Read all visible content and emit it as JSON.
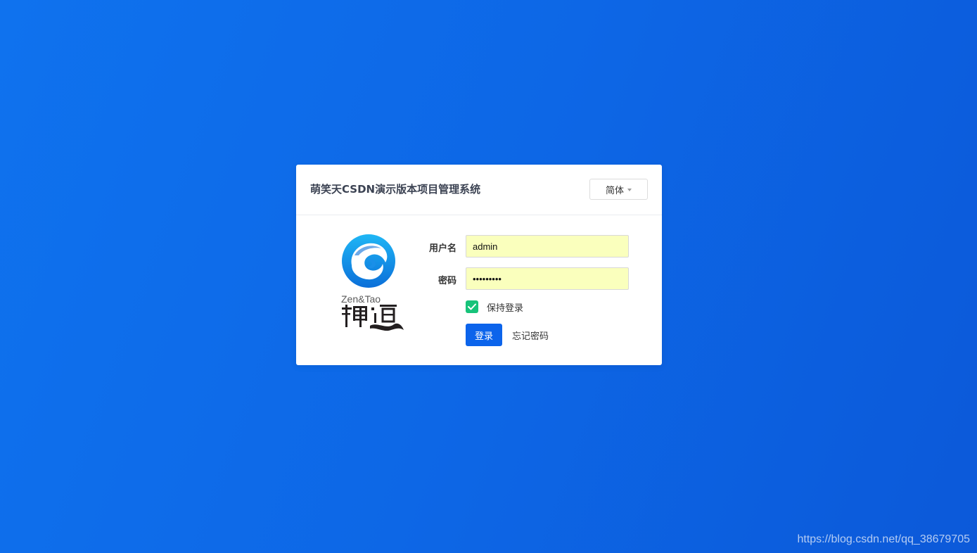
{
  "login": {
    "title": "萌笑天CSDN演示版本项目管理系统",
    "language": "简体",
    "username_label": "用户名",
    "username_value": "admin",
    "password_label": "密码",
    "password_value": "123456789",
    "remember_label": "保持登录",
    "remember_checked": true,
    "submit_label": "登录",
    "forgot_label": "忘记密码"
  },
  "logo": {
    "text": "Zen&Tao",
    "chinese": "禪道"
  },
  "watermark": "https://blog.csdn.net/qq_38679705",
  "colors": {
    "background": "#0d67e6",
    "primary_button": "#0c64eb",
    "checkbox": "#17c37a",
    "autofill_input": "#faffbd"
  }
}
